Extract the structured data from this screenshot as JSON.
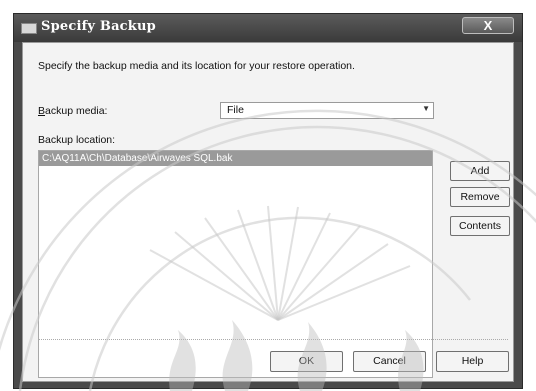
{
  "dialog": {
    "title": "Specify Backup",
    "close_glyph": "X",
    "instruction": "Specify the backup media and its location for your restore operation.",
    "backup_media": {
      "label_prefix": "B",
      "label_rest": "ackup media:",
      "value": "File"
    },
    "backup_location": {
      "label": "Backup location:",
      "items": [
        "C:\\AQ11A\\Ch\\Database\\Airwaves SQL.bak"
      ]
    },
    "buttons": {
      "add": "Add",
      "remove": "Remove",
      "contents": "Contents",
      "ok": "OK",
      "cancel": "Cancel",
      "help": "Help"
    }
  },
  "colors": {
    "titlebar": "#4a4a4a",
    "client_bg": "#f3f3f3",
    "selection": "#9a9a9a"
  }
}
